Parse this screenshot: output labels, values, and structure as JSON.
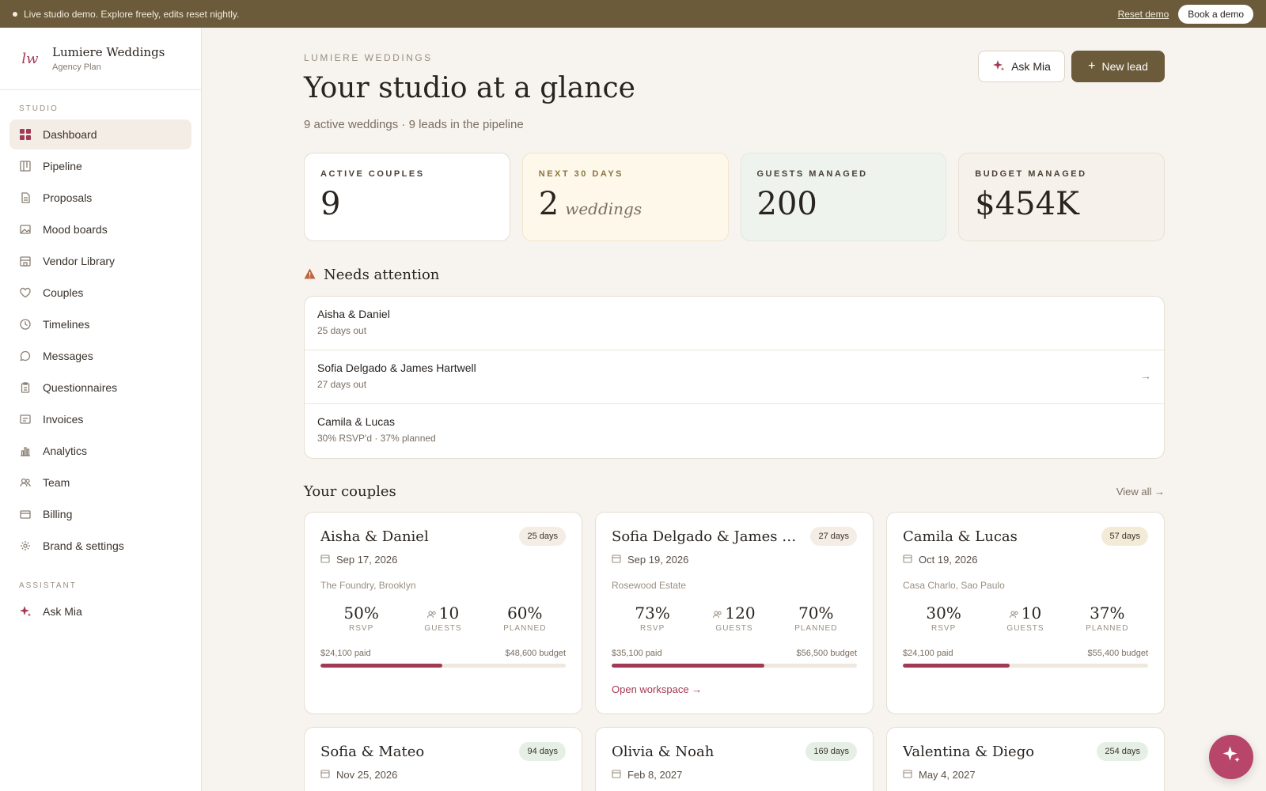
{
  "banner": {
    "text": "Live studio demo. Explore freely, edits reset nightly.",
    "reset": "Reset demo",
    "book": "Book a demo"
  },
  "brand": {
    "name": "Lumiere Weddings",
    "plan": "Agency Plan",
    "logo": "lw"
  },
  "sidebar": {
    "section_studio": "STUDIO",
    "section_assistant": "ASSISTANT",
    "items": [
      {
        "label": "Dashboard",
        "icon": "grid-icon"
      },
      {
        "label": "Pipeline",
        "icon": "kanban-icon"
      },
      {
        "label": "Proposals",
        "icon": "document-icon"
      },
      {
        "label": "Mood boards",
        "icon": "image-icon"
      },
      {
        "label": "Vendor Library",
        "icon": "store-icon"
      },
      {
        "label": "Couples",
        "icon": "heart-icon"
      },
      {
        "label": "Timelines",
        "icon": "clock-icon"
      },
      {
        "label": "Messages",
        "icon": "chat-icon"
      },
      {
        "label": "Questionnaires",
        "icon": "clipboard-icon"
      },
      {
        "label": "Invoices",
        "icon": "invoice-icon"
      },
      {
        "label": "Analytics",
        "icon": "bar-chart-icon"
      },
      {
        "label": "Team",
        "icon": "users-icon"
      },
      {
        "label": "Billing",
        "icon": "card-icon"
      },
      {
        "label": "Brand & settings",
        "icon": "gear-icon"
      }
    ],
    "assistant": {
      "label": "Ask Mia",
      "icon": "sparkle-icon"
    }
  },
  "header": {
    "eyebrow": "LUMIERE WEDDINGS",
    "title": "Your studio at a glance",
    "subtitle": "9 active weddings · 9 leads in the pipeline",
    "ask_label": "Ask Mia",
    "new_label": "New lead"
  },
  "stats": [
    {
      "label": "ACTIVE COUPLES",
      "value": "9",
      "unit": ""
    },
    {
      "label": "NEXT 30 DAYS",
      "value": "2",
      "unit": "weddings"
    },
    {
      "label": "GUESTS MANAGED",
      "value": "200",
      "unit": ""
    },
    {
      "label": "BUDGET MANAGED",
      "value": "$454K",
      "unit": ""
    }
  ],
  "attention": {
    "title": "Needs attention",
    "rows": [
      {
        "name": "Aisha & Daniel",
        "meta": "25 days out"
      },
      {
        "name": "Sofia Delgado & James Hartwell",
        "meta": "27 days out"
      },
      {
        "name": "Camila & Lucas",
        "meta": "30% RSVP'd · 37% planned"
      }
    ]
  },
  "couples": {
    "title": "Your couples",
    "view_all": "View all →",
    "rsvp_label": "RSVP",
    "guests_label": "GUESTS",
    "planned_label": "PLANNED",
    "open_workspace": "Open workspace →",
    "cards": [
      {
        "name": "Aisha & Daniel",
        "days": "25 days",
        "date": "Sep 17, 2026",
        "venue": "The Foundry, Brooklyn",
        "rsvp": "50%",
        "guests": "10",
        "planned": "60%",
        "paid": "$24,100 paid",
        "budget": "$48,600 budget",
        "progress": 0.496
      },
      {
        "name": "Sofia Delgado & James Har...",
        "days": "27 days",
        "date": "Sep 19, 2026",
        "venue": "Rosewood Estate",
        "rsvp": "73%",
        "guests": "120",
        "planned": "70%",
        "paid": "$35,100 paid",
        "budget": "$56,500 budget",
        "progress": 0.621
      },
      {
        "name": "Camila & Lucas",
        "days": "57 days",
        "date": "Oct 19, 2026",
        "venue": "Casa Charlo, Sao Paulo",
        "rsvp": "30%",
        "guests": "10",
        "planned": "37%",
        "paid": "$24,100 paid",
        "budget": "$55,400 budget",
        "progress": 0.435
      },
      {
        "name": "Sofia & Mateo",
        "days": "94 days",
        "date": "Nov 25, 2026"
      },
      {
        "name": "Olivia & Noah",
        "days": "169 days",
        "date": "Feb 8, 2027"
      },
      {
        "name": "Valentina & Diego",
        "days": "254 days",
        "date": "May 4, 2027"
      }
    ]
  },
  "colors": {
    "accent": "#a33a55",
    "olive": "#6b5b3a",
    "background": "#f7f3ee"
  }
}
